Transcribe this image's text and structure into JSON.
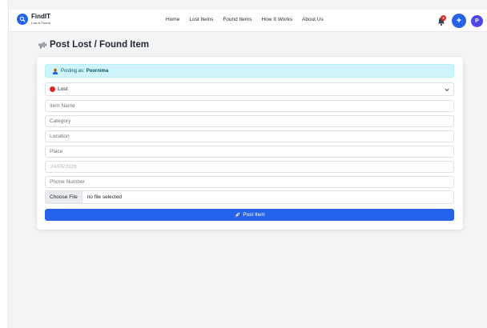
{
  "brand": {
    "title": "FindIT",
    "subtitle": "Lost & Found",
    "logo_icon": "search-icon"
  },
  "nav": {
    "links": [
      "Home",
      "Lost Items",
      "Found Items",
      "How It Works",
      "About Us"
    ],
    "notification_badge": "3",
    "add_label": "+",
    "avatar_initial": "P"
  },
  "page": {
    "title": "Post Lost / Found Item",
    "title_icon": "megaphone-icon"
  },
  "alert": {
    "prefix": "Posting as:",
    "user": "Poornima",
    "icon": "user-icon"
  },
  "form": {
    "type_selected": "Lost",
    "item_name_placeholder": "Item Name",
    "category_placeholder": "Category",
    "location_placeholder": "Location",
    "place_placeholder": "Place",
    "date_value": "24/05/2026",
    "phone_placeholder": "Phone Number",
    "file_button": "Choose File",
    "file_status": "no file selected",
    "submit_label": "Post Item",
    "submit_icon": "rocket-icon"
  },
  "colors": {
    "accent": "#2563eb",
    "alert_bg": "#cff4fc",
    "lost_dot": "#dc2626",
    "avatar": "#4f46e5"
  }
}
